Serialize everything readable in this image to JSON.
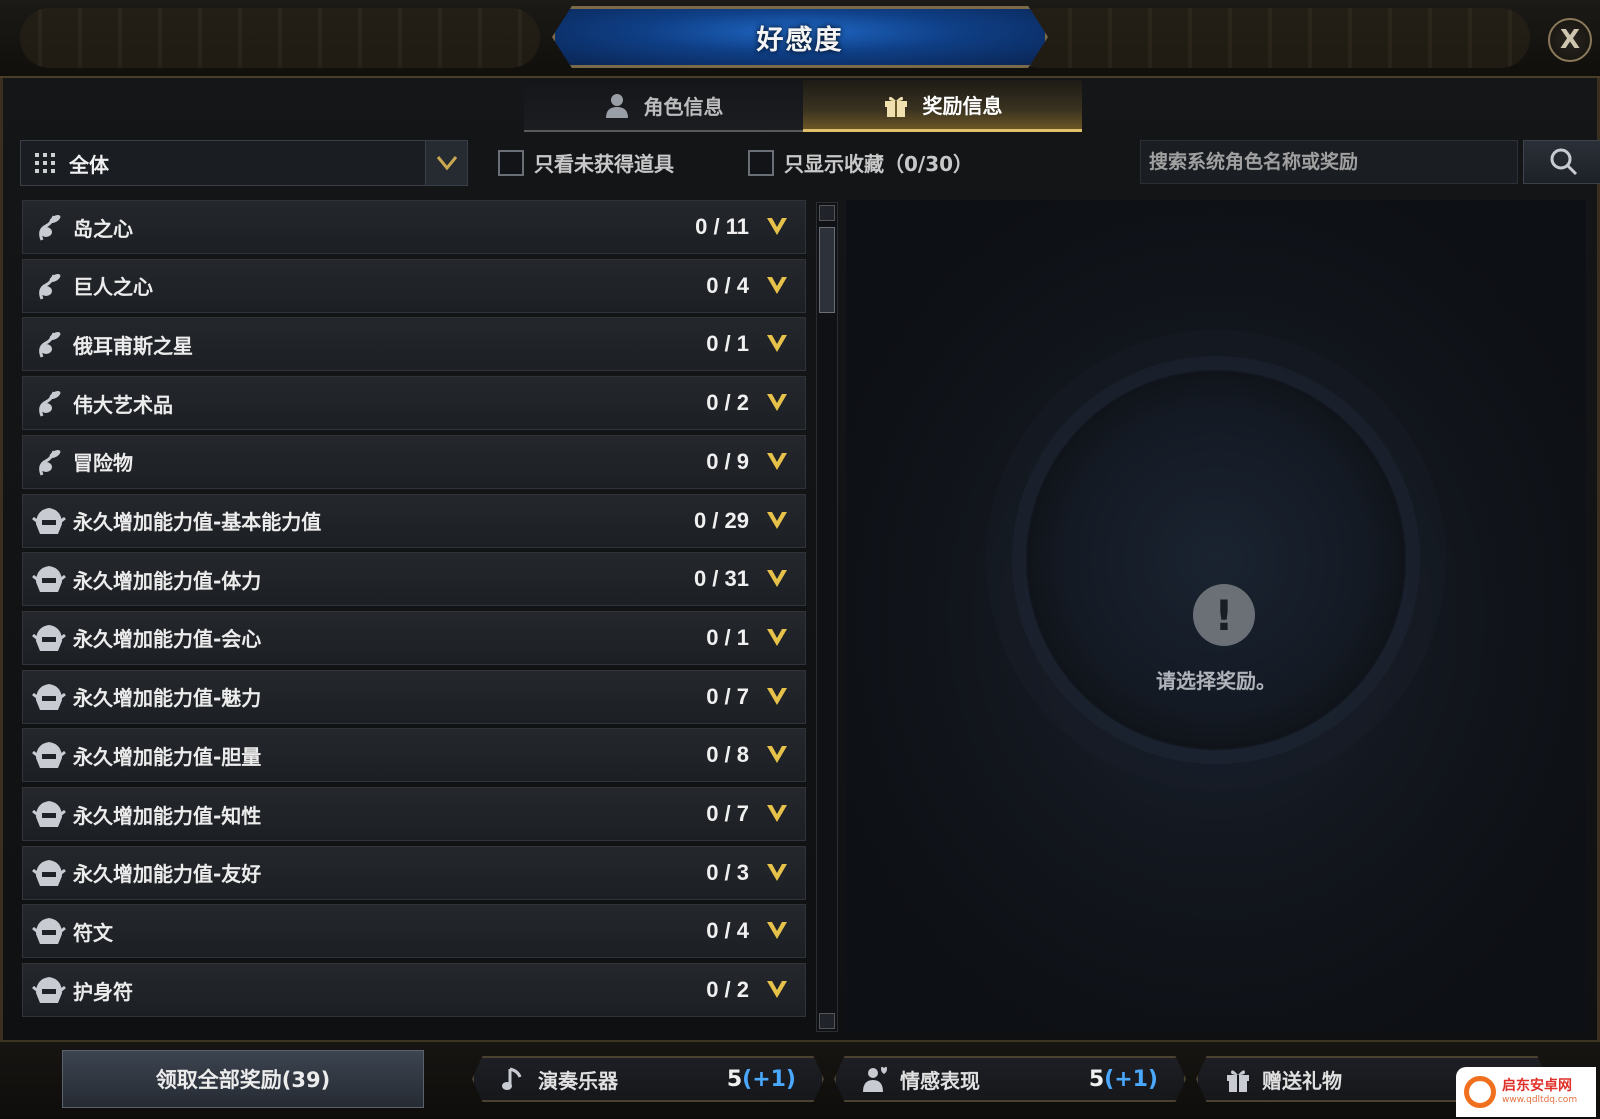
{
  "window": {
    "title": "好感度",
    "close_label": "X"
  },
  "tabs": [
    {
      "label": "角色信息",
      "icon": "person-icon",
      "active": false
    },
    {
      "label": "奖励信息",
      "icon": "gift-icon",
      "active": true
    }
  ],
  "filter": {
    "dropdown_value": "全体",
    "checkbox_unobtained": "只看未获得道具",
    "checkbox_favorites": "只显示收藏（0/30）",
    "search_placeholder": "搜索系统角色名称或奖励"
  },
  "rewards": [
    {
      "name": "岛之心",
      "count": "0 / 11",
      "icon": "seed-icon"
    },
    {
      "name": "巨人之心",
      "count": "0 / 4",
      "icon": "seed-icon"
    },
    {
      "name": "俄耳甫斯之星",
      "count": "0 / 1",
      "icon": "seed-icon"
    },
    {
      "name": "伟大艺术品",
      "count": "0 / 2",
      "icon": "seed-icon"
    },
    {
      "name": "冒险物",
      "count": "0 / 9",
      "icon": "seed-icon"
    },
    {
      "name": "永久增加能力值-基本能力值",
      "count": "0 / 29",
      "icon": "helmet-icon"
    },
    {
      "name": "永久增加能力值-体力",
      "count": "0 / 31",
      "icon": "helmet-icon"
    },
    {
      "name": "永久增加能力值-会心",
      "count": "0 / 1",
      "icon": "helmet-icon"
    },
    {
      "name": "永久增加能力值-魅力",
      "count": "0 / 7",
      "icon": "helmet-icon"
    },
    {
      "name": "永久增加能力值-胆量",
      "count": "0 / 8",
      "icon": "helmet-icon"
    },
    {
      "name": "永久增加能力值-知性",
      "count": "0 / 7",
      "icon": "helmet-icon"
    },
    {
      "name": "永久增加能力值-友好",
      "count": "0 / 3",
      "icon": "helmet-icon"
    },
    {
      "name": "符文",
      "count": "0 / 4",
      "icon": "helmet-icon"
    },
    {
      "name": "护身符",
      "count": "0 / 2",
      "icon": "helmet-icon"
    }
  ],
  "detail": {
    "hint": "请选择奖励。"
  },
  "bottom": {
    "claim_all": "领取全部奖励(39)",
    "stats": [
      {
        "label": "演奏乐器",
        "value": "5",
        "bonus": "(+1)",
        "icon": "music-note-icon"
      },
      {
        "label": "情感表现",
        "value": "5",
        "bonus": "(+1)",
        "icon": "emote-icon"
      },
      {
        "label": "赠送礼物",
        "value": "",
        "bonus": "",
        "icon": "gift-icon"
      }
    ]
  },
  "watermark": {
    "title": "启东安卓网",
    "url": "www.qdltdq.com"
  },
  "colors": {
    "accent_gold": "#e0c068",
    "bonus_blue": "#4aa8ff",
    "title_blue": "#1f67c4"
  }
}
